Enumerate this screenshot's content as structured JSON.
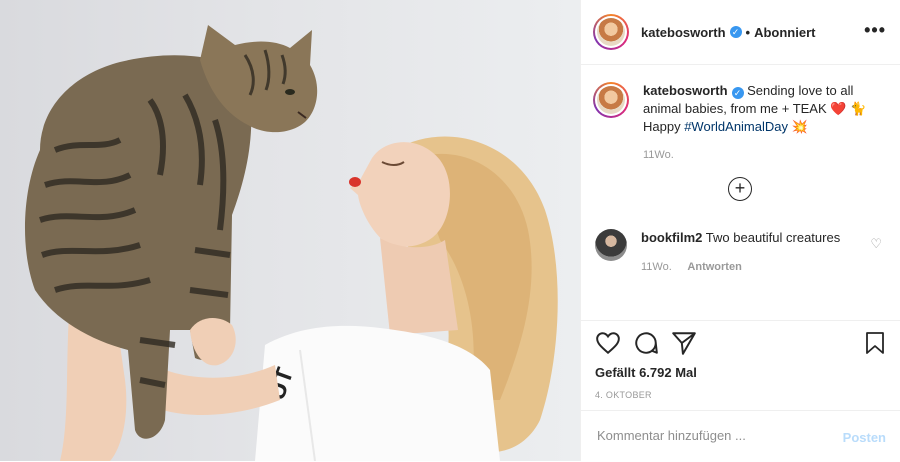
{
  "colors": {
    "accent": "#3897f0",
    "hashtag": "#003569",
    "muted": "#999999",
    "post_disabled": "#b9dcfb"
  },
  "header": {
    "username": "katebosworth",
    "verified_icon": "verified-badge-icon",
    "separator": "•",
    "follow_status": "Abonniert",
    "more_label": "•••"
  },
  "caption": {
    "username": "katebosworth",
    "text_before_hashtag": "Sending love to all animal babies, from me + TEAK ❤️ 🐈",
    "hashtag_prefix": "Happy",
    "hashtag": "#WorldAnimalDay",
    "emoji_after": "💥",
    "age": "11Wo."
  },
  "load_more_label": "+",
  "comments": [
    {
      "username": "bookfilm2",
      "text": "Two beautiful creatures",
      "age": "11Wo.",
      "reply_label": "Antworten"
    }
  ],
  "actions": {
    "icons": [
      "heart-icon",
      "comment-icon",
      "share-icon",
      "bookmark-icon"
    ],
    "likes_text": "Gefällt 6.792 Mal",
    "date": "4. OKTOBER"
  },
  "add_comment": {
    "placeholder": "Kommentar hinzufügen ...",
    "post_label": "Posten"
  }
}
